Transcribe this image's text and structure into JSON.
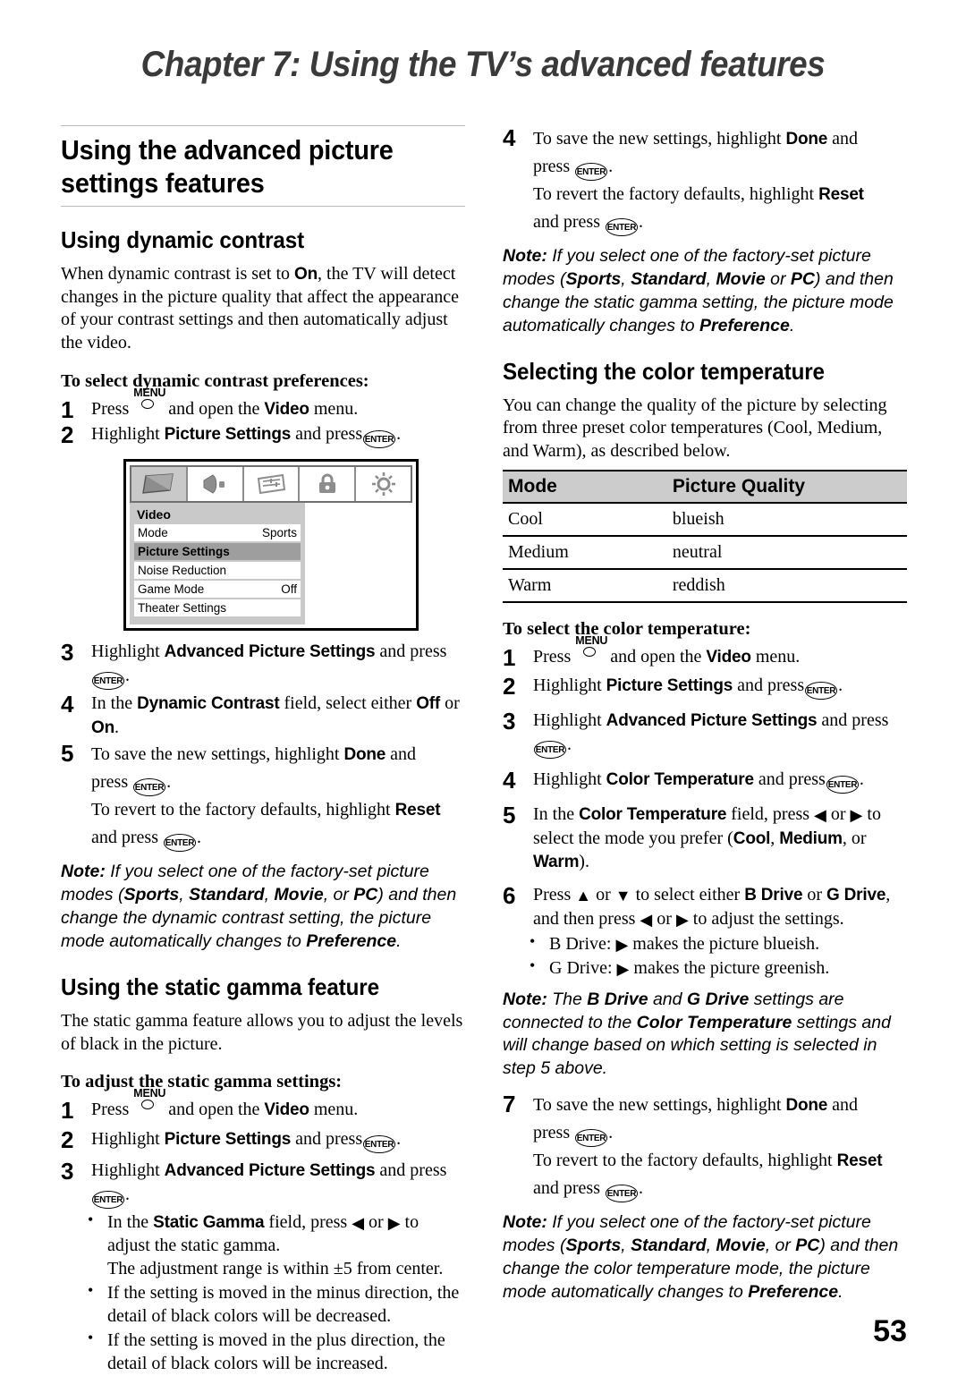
{
  "chapter": {
    "title": "Chapter 7: Using the TV’s advanced features"
  },
  "page_number": "53",
  "keys": {
    "menu_label": "MENU",
    "enter_label": "ENTER"
  },
  "left_column": {
    "section_title": "Using the advanced picture settings features",
    "dynamic_contrast": {
      "heading": "Using dynamic contrast",
      "intro_1": "When dynamic contrast is set to ",
      "intro_on": "On",
      "intro_2": ", the TV will detect changes in the picture quality that affect the appearance of your contrast settings and then automatically adjust the video.",
      "task_title": "To select dynamic contrast preferences:",
      "step1_a": "Press",
      "step1_b": "and open the",
      "step1_menu": "Video",
      "step1_c": "menu.",
      "step2_a": "Highlight",
      "step2_item": "Picture Settings",
      "step2_b": "and press",
      "step3_a": "Highlight",
      "step3_item": "Advanced Picture Settings",
      "step3_b": "and press",
      "step4_a": "In the",
      "step4_field": "Dynamic Contrast",
      "step4_b": "field, select either",
      "step4_off": "Off",
      "step4_or": "or",
      "step4_on": "On",
      "step4_end": ".",
      "step5_a": "To save the new settings, highlight",
      "step5_done": "Done",
      "step5_b": "and press",
      "step5_c": "To revert to the factory defaults, highlight",
      "step5_reset": "Reset",
      "step5_d": "and press",
      "note_label": "Note:",
      "note_1": " If you select one of the factory-set picture modes (",
      "note_mode1": "Sports",
      "note_sep1": ", ",
      "note_mode2": "Standard",
      "note_sep2": ", ",
      "note_mode3": "Movie",
      "note_sep3": ", or ",
      "note_mode4": "PC",
      "note_2": ") and then change the dynamic contrast setting, the picture mode automatically changes to ",
      "note_pref": "Preference",
      "note_3": "."
    },
    "tv_menu": {
      "icons": [
        "picture-screen-icon",
        "speaker-icon",
        "sliders-icon",
        "lock-icon",
        "brightness-sun-icon"
      ],
      "panel_title": "Video",
      "rows": [
        {
          "label": "Mode",
          "value": "Sports",
          "highlighted": false
        },
        {
          "label": "Picture Settings",
          "value": "",
          "highlighted": true
        },
        {
          "label": "Noise Reduction",
          "value": "",
          "highlighted": false
        },
        {
          "label": "Game Mode",
          "value": "Off",
          "highlighted": false
        },
        {
          "label": "Theater Settings",
          "value": "",
          "highlighted": false
        }
      ]
    },
    "static_gamma": {
      "heading": "Using the static gamma feature",
      "intro": "The static gamma feature allows you to adjust the levels of black in the picture.",
      "task_title": "To adjust the static gamma settings:",
      "step1_a": "Press",
      "step1_b": "and open the",
      "step1_menu": "Video",
      "step1_c": "menu.",
      "step2_a": "Highlight",
      "step2_item": "Picture Settings",
      "step2_b": "and press",
      "step3_a": "Highlight",
      "step3_item": "Advanced Picture Settings",
      "step3_b": "and press",
      "bullet1_a": "In the",
      "bullet1_field": "Static Gamma",
      "bullet1_b": "field, press",
      "bullet1_or": "or",
      "bullet1_c": "to adjust the static gamma.",
      "bullet1_d": "The adjustment range is within ±5 from center.",
      "bullet2": "If the setting is moved in the minus direction, the detail of black colors will be decreased.",
      "bullet3": "If the setting is moved in the plus direction, the detail of black colors will be increased."
    }
  },
  "right_column": {
    "gamma_steps": {
      "step4_a": "To save the new settings, highlight",
      "step4_done": "Done",
      "step4_b": "and press",
      "step4_c": "To revert the factory defaults, highlight",
      "step4_reset": "Reset",
      "step4_d": "and press",
      "note_label": "Note:",
      "note_1": " If you select one of the factory-set picture modes (",
      "note_mode1": "Sports",
      "note_sep1": ", ",
      "note_mode2": "Standard",
      "note_sep2": ", ",
      "note_mode3": "Movie",
      "note_sep3": " or ",
      "note_mode4": "PC",
      "note_2": ") and then change the static gamma setting, the picture mode automatically changes to ",
      "note_pref": "Preference",
      "note_3": "."
    },
    "color_temperature": {
      "heading": "Selecting the color temperature",
      "intro": "You can change the quality of the picture by selecting from three preset color temperatures (Cool, Medium, and Warm), as described below.",
      "table": {
        "headers": [
          "Mode",
          "Picture Quality"
        ],
        "rows": [
          [
            "Cool",
            "blueish"
          ],
          [
            "Medium",
            "neutral"
          ],
          [
            "Warm",
            "reddish"
          ]
        ]
      },
      "task_title": "To select the color temperature:",
      "step1_a": "Press",
      "step1_b": "and open the",
      "step1_menu": "Video",
      "step1_c": "menu.",
      "step2_a": "Highlight",
      "step2_item": "Picture Settings",
      "step2_b": "and press",
      "step3_a": "Highlight",
      "step3_item": "Advanced Picture Settings",
      "step3_b": "and press",
      "step4_a": "Highlight",
      "step4_item": "Color Temperature",
      "step4_b": "and press",
      "step5_a": "In the",
      "step5_field": "Color Temperature",
      "step5_b": "field, press",
      "step5_or": "or",
      "step5_c": "to select the mode you prefer (",
      "step5_cool": "Cool",
      "step5_sep1": ", ",
      "step5_medium": "Medium",
      "step5_sep2": ", or ",
      "step5_warm": "Warm",
      "step5_end": ").",
      "step6_a": "Press",
      "step6_or": "or",
      "step6_b": "to select either",
      "step6_bdrive": "B Drive",
      "step6_or2": "or",
      "step6_gdrive": "G Drive",
      "step6_c": ", and then press",
      "step6_or3": "or",
      "step6_d": "to adjust the settings.",
      "bullet_b": "B Drive:",
      "bullet_b_rest": "makes the picture blueish.",
      "bullet_g": "G Drive:",
      "bullet_g_rest": "makes the picture greenish.",
      "note6_label": "Note:",
      "note6_1": " The ",
      "note6_bdrive": "B Drive",
      "note6_2": " and ",
      "note6_gdrive": "G Drive",
      "note6_3": " settings are connected to the ",
      "note6_ct": "Color Temperature",
      "note6_4": " settings and will change based on which setting is selected in step 5 above.",
      "step7_a": "To save the new settings, highlight",
      "step7_done": "Done",
      "step7_b": "and press",
      "step7_c": "To revert to the factory defaults, highlight",
      "step7_reset": "Reset",
      "step7_d": "and press",
      "note7_label": "Note:",
      "note7_1": " If you select one of the factory-set picture modes (",
      "note7_mode1": "Sports",
      "note7_sep1": ", ",
      "note7_mode2": "Standard",
      "note7_sep2": ", ",
      "note7_mode3": "Movie",
      "note7_sep3": ", or ",
      "note7_mode4": "PC",
      "note7_2": ") and then change the color temperature mode, the picture mode automatically changes to ",
      "note7_pref": "Preference",
      "note7_3": "."
    }
  },
  "step_numbers": {
    "n1": "1",
    "n2": "2",
    "n3": "3",
    "n4": "4",
    "n5": "5",
    "n6": "6",
    "n7": "7"
  }
}
